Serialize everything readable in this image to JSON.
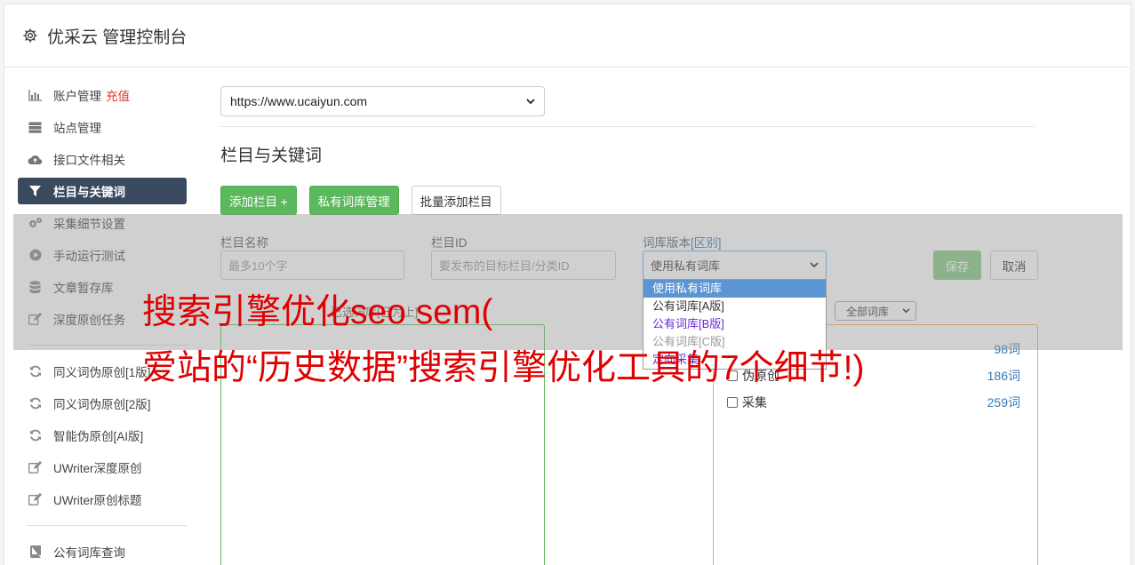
{
  "header": {
    "title": "优采云 管理控制台"
  },
  "sidebar": {
    "items": [
      {
        "label": "账户管理",
        "badge": "充值",
        "icon": "bar-chart-icon"
      },
      {
        "label": "站点管理",
        "icon": "server-icon"
      },
      {
        "label": "接口文件相关",
        "icon": "cloud-upload-icon"
      },
      {
        "label": "栏目与关键词",
        "icon": "filter-icon",
        "active": true
      },
      {
        "label": "采集细节设置",
        "icon": "gears-icon"
      },
      {
        "label": "手动运行测试",
        "icon": "play-circle-icon"
      },
      {
        "label": "文章暂存库",
        "icon": "database-icon"
      },
      {
        "label": "深度原创任务",
        "icon": "edit-icon"
      }
    ],
    "items2": [
      {
        "label": "同义词伪原创[1版]",
        "icon": "refresh-icon"
      },
      {
        "label": "同义词伪原创[2版]",
        "icon": "refresh-icon"
      },
      {
        "label": "智能伪原创[AI版]",
        "icon": "refresh-icon"
      },
      {
        "label": "UWriter深度原创",
        "icon": "edit-icon"
      },
      {
        "label": "UWriter原创标题",
        "icon": "edit-icon"
      }
    ],
    "items3": [
      {
        "label": "公有词库查询",
        "icon": "book-icon"
      }
    ]
  },
  "main": {
    "site_select": "https://www.ucaiyun.com",
    "section_title": "栏目与关键词",
    "buttons": {
      "add_column": "添加栏目 +",
      "private_lib": "私有词库管理",
      "batch_add": "批量添加栏目"
    }
  },
  "form": {
    "name_label": "栏目名称",
    "name_placeholder": "最多10个字",
    "id_label": "栏目ID",
    "id_placeholder": "要发布的目标栏目/分类ID",
    "version_label": "词库版本",
    "version_link": "[区别]",
    "version_value": "使用私有词库",
    "save": "保存",
    "cancel": "取消",
    "version_options": [
      "使用私有词库",
      "公有词库[A版]",
      "公有词库[B版]",
      "公有词库[C版]",
      "定向采集"
    ],
    "box_caption": "已选词库[已为上]",
    "lib_select": "全部词库",
    "words": [
      {
        "name": "",
        "count": "98词"
      },
      {
        "name": "伪原创",
        "count": "186词"
      },
      {
        "name": "采集",
        "count": "259词"
      }
    ]
  },
  "watermark": {
    "line1": "搜索引擎优化seo sem(",
    "line2": "爱站的“历史数据”搜索引擎优化工具的7个细节!)"
  },
  "colors": {
    "active_nav": "#3a4a5e",
    "green": "#5cb85c",
    "badge_red": "#e3342f",
    "watermark": "#e00000",
    "link_blue": "#337ab7"
  }
}
